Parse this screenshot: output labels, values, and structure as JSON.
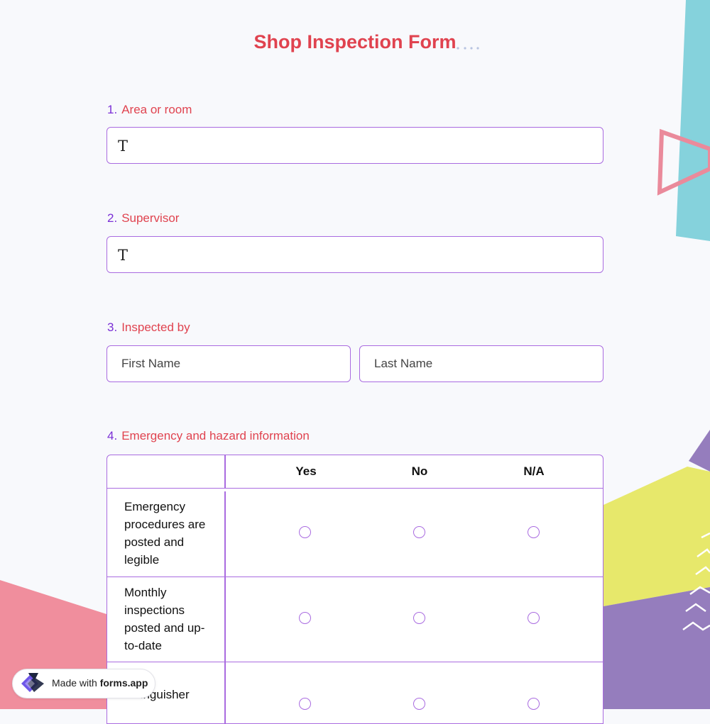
{
  "form": {
    "title": "Shop Inspection Form"
  },
  "questions": [
    {
      "number": "1.",
      "label": "Area or room",
      "input_icon": "T"
    },
    {
      "number": "2.",
      "label": "Supervisor",
      "input_icon": "T"
    },
    {
      "number": "3.",
      "label": "Inspected by",
      "first_placeholder": "First Name",
      "last_placeholder": "Last Name"
    },
    {
      "number": "4.",
      "label": "Emergency and hazard information"
    }
  ],
  "grid": {
    "columns": [
      "Yes",
      "No",
      "N/A"
    ],
    "rows": [
      {
        "label": "Emergency procedures are posted and legible"
      },
      {
        "label": "Monthly inspections posted and up-to-date"
      },
      {
        "label": "extinguisher"
      }
    ]
  },
  "badge": {
    "prefix": "Made with",
    "brand": "forms.app"
  },
  "colors": {
    "title": "#e0434f",
    "number": "#7b2fd6",
    "border": "#a96be0",
    "teal": "#85d2dc",
    "pink": "#f08e9d",
    "purple": "#957dbd",
    "yellow": "#e7e86b"
  }
}
